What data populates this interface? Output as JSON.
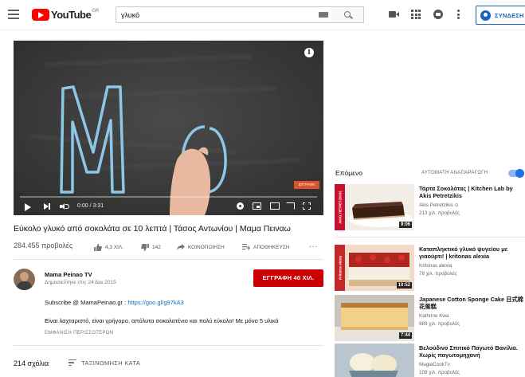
{
  "header": {
    "logo_text": "YouTube",
    "logo_country": "GR",
    "search_value": "γλυκό",
    "signin_label": "ΣΥΝΔΕΣΗ"
  },
  "player": {
    "time": "0:00 / 3:31",
    "progress": 0.0,
    "watermark": "ΕΓΓΡΑΦΗ",
    "chalk_letters": "Mo"
  },
  "video": {
    "title": "Εύκολο γλυκό από σοκολάτα σε 10 λεπτά | Τάσος Αντωνίου | Μαμα Πειναω",
    "views": "284.455 προβολές",
    "likes": "4,3 ΧΙΛ.",
    "dislikes": "142",
    "share_label": "ΚΟΙΝΟΠΟΙΗΣΗ",
    "save_label": "ΑΠΟΘΗΚΕΥΣΗ",
    "more": "..."
  },
  "channel": {
    "name": "Mama Peinao TV",
    "published": "Δημοσιεύτηκε στις 24 Δεκ 2015",
    "subscribe_label": "ΕΓΓΡΑΦΗ  40 ΧΙΛ."
  },
  "description": {
    "line1_text": "Subscribe @ MamaPeinao.gr : ",
    "line1_link": "https://goo.gl/g97kA3",
    "line2": "Είναι λαχταριστό, είναι γρήγορο, απόλυτα σοκολατένιο και πολύ εύκολο! Με μόνο 5 υλικά",
    "show_more": "ΕΜΦΑΝΙΣΗ ΠΕΡΙΣΣΟΤΕΡΩΝ"
  },
  "comments": {
    "count": "214 σχόλια",
    "sort_label": "ΤΑΞΙΝΟΜΗΣΗ ΚΑΤΑ"
  },
  "sidebar": {
    "up_next": "Επόμενο",
    "autoplay_label": "ΑΥΤΟΜΑΤΗ ΑΝΑΠΑΡΑΓΩΓΗ",
    "autoplay_on": true,
    "items": [
      {
        "title": "Τάρτα Σοκολάτας | Kitchen Lab by Akis Petretzikis",
        "channel": "Akis Petretzikis ⊙",
        "views": "213 χιλ. προβολές",
        "duration": "9:06",
        "thumb_tag": "ΑΚΗΣ ΠΕΤΡΕΤΖΙΚΗΣ"
      },
      {
        "title": "Καταπληκτικό γλυκό ψυγείου με γιαούρτι! | kritonas alexia",
        "channel": "Kritonas alexia",
        "views": "78 χιλ. προβολές",
        "duration": "10:52",
        "thumb_tag": "Kritonas alexia"
      },
      {
        "title": "Japanese Cotton Sponge Cake 日式棉花蛋糕",
        "channel": "Kathrine Kwa",
        "views": "689 χιλ. προβολές",
        "duration": "7:44",
        "thumb_tag": ""
      },
      {
        "title": "Βελούδινο Σπιτικό Παγωτό Βανίλια. Χωρίς παγωτομηχανή",
        "channel": "MagiaCookTv",
        "views": "109 χιλ. προβολές",
        "duration": "",
        "thumb_tag": ""
      }
    ]
  }
}
